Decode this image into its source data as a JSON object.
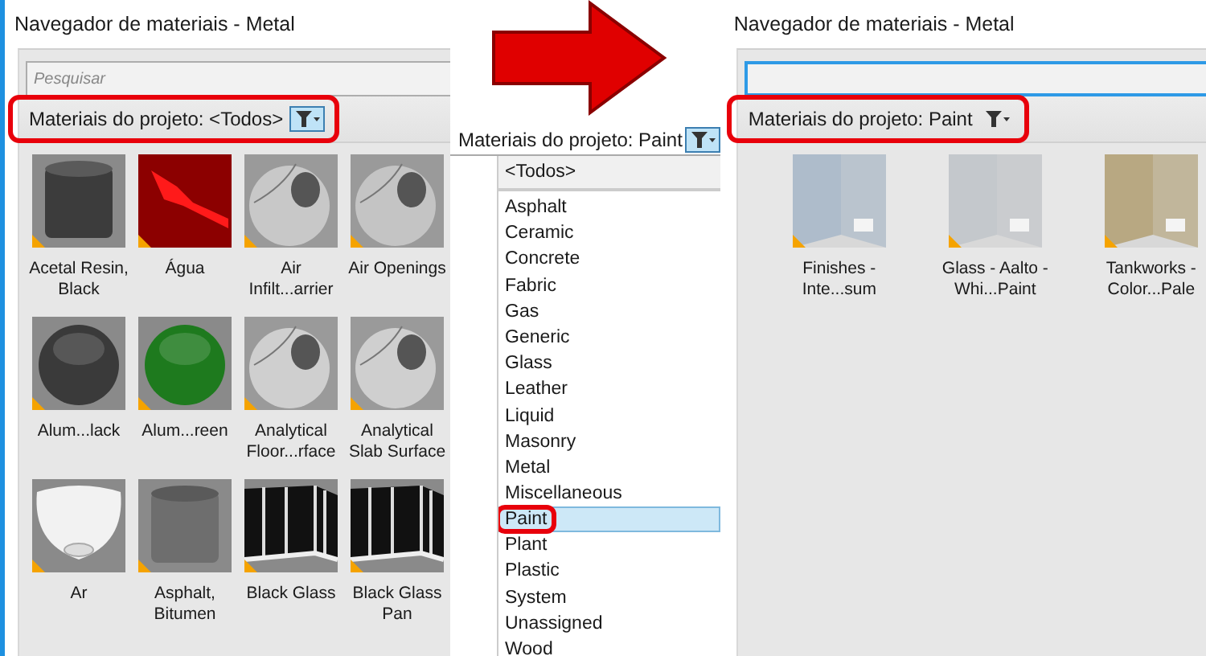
{
  "left_panel": {
    "title": "Navegador de materiais - Metal",
    "search": {
      "placeholder": "Pesquisar",
      "focused": false
    },
    "filter": {
      "label": "Materiais do projeto: <Todos>",
      "button_active": true,
      "highlighted": true
    },
    "materials": [
      {
        "name": "Acetal Resin, Black",
        "kind": "cylinder",
        "color": "#3c3c3c"
      },
      {
        "name": "Água",
        "kind": "water",
        "color": "#ff1a1a"
      },
      {
        "name": "Air Infilt...arrier",
        "kind": "hollow-sphere",
        "color": "#c8c8c8"
      },
      {
        "name": "Air Openings",
        "kind": "hollow-sphere",
        "color": "#c4c4c4"
      },
      {
        "name": "Alum...lack",
        "kind": "sphere",
        "color": "#3a3a3a"
      },
      {
        "name": "Alum...reen",
        "kind": "sphere",
        "color": "#1e7a1e"
      },
      {
        "name": "Analytical Floor...rface",
        "kind": "hollow-sphere",
        "color": "#cfcfcf"
      },
      {
        "name": "Analytical Slab Surface",
        "kind": "hollow-sphere",
        "color": "#cfcfcf"
      },
      {
        "name": "Ar",
        "kind": "bowl",
        "color": "#f2f2f2"
      },
      {
        "name": "Asphalt, Bitumen",
        "kind": "cylinder",
        "color": "#6e6e6e"
      },
      {
        "name": "Black Glass",
        "kind": "glass-panel",
        "color": "#111111"
      },
      {
        "name": "Black Glass Pan",
        "kind": "glass-panel",
        "color": "#111111"
      }
    ]
  },
  "dropdown": {
    "filter": {
      "label": "Materiais do projeto: Paint",
      "button_active": true
    },
    "options": [
      {
        "label": "<Todos>",
        "selected": false,
        "highlighted": false
      },
      {
        "label": "Asphalt",
        "selected": false,
        "highlighted": false
      },
      {
        "label": "Ceramic",
        "selected": false,
        "highlighted": false
      },
      {
        "label": "Concrete",
        "selected": false,
        "highlighted": false
      },
      {
        "label": "Fabric",
        "selected": false,
        "highlighted": false
      },
      {
        "label": "Gas",
        "selected": false,
        "highlighted": false
      },
      {
        "label": "Generic",
        "selected": false,
        "highlighted": false
      },
      {
        "label": "Glass",
        "selected": false,
        "highlighted": false
      },
      {
        "label": "Leather",
        "selected": false,
        "highlighted": false
      },
      {
        "label": "Liquid",
        "selected": false,
        "highlighted": false
      },
      {
        "label": "Masonry",
        "selected": false,
        "highlighted": false
      },
      {
        "label": "Metal",
        "selected": false,
        "highlighted": false
      },
      {
        "label": "Miscellaneous",
        "selected": false,
        "highlighted": false
      },
      {
        "label": "Paint",
        "selected": true,
        "highlighted": true
      },
      {
        "label": "Plant",
        "selected": false,
        "highlighted": false
      },
      {
        "label": "Plastic",
        "selected": false,
        "highlighted": false
      },
      {
        "label": "System",
        "selected": false,
        "highlighted": false
      },
      {
        "label": "Unassigned",
        "selected": false,
        "highlighted": false
      },
      {
        "label": "Wood",
        "selected": false,
        "highlighted": false
      }
    ]
  },
  "right_panel": {
    "title": "Navegador de materiais - Metal",
    "search": {
      "focused": true
    },
    "filter": {
      "label": "Materiais do projeto: Paint",
      "button_active": false,
      "highlighted": true
    },
    "materials": [
      {
        "name": "Finishes - Inte...sum",
        "kind": "room",
        "color": "#aebccb"
      },
      {
        "name": "Glass - Aalto - Whi...Paint",
        "kind": "room",
        "color": "#c4c8cc"
      },
      {
        "name": "Tankworks - Color...Pale",
        "kind": "room",
        "color": "#b8a882"
      }
    ]
  }
}
